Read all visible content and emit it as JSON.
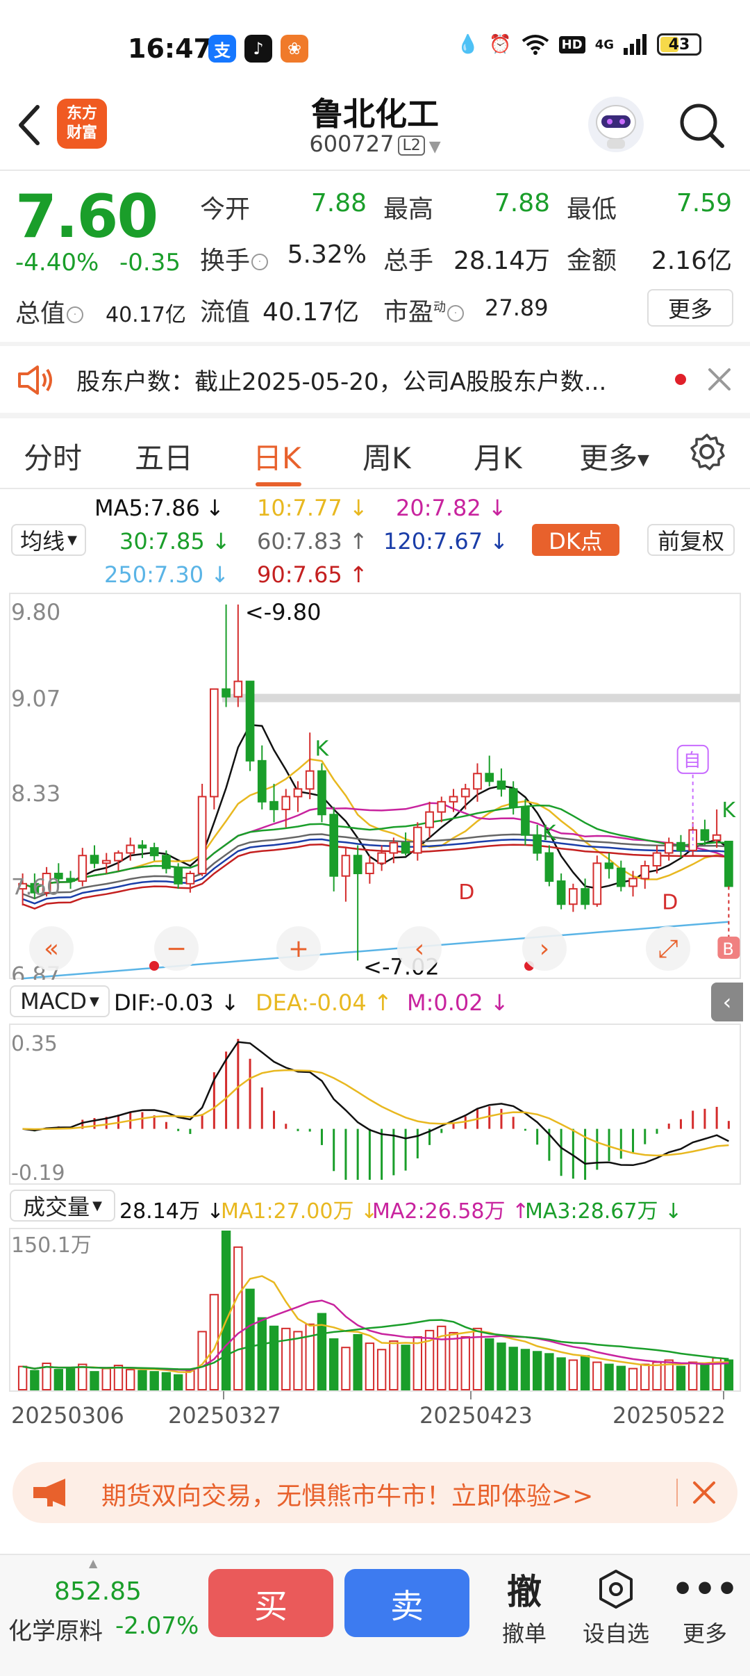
{
  "status_bar": {
    "time": "16:47",
    "app_icons": [
      "支",
      "♪",
      "❀"
    ],
    "network": "4G",
    "hd": "HD",
    "battery": "43"
  },
  "header": {
    "logo_line1": "东方",
    "logo_line2": "财富",
    "title": "鲁北化工",
    "code": "600727",
    "level": "L2"
  },
  "quote": {
    "price": "7.60",
    "change_pct": "-4.40%",
    "change": "-0.35",
    "open_label": "今开",
    "open": "7.88",
    "high_label": "最高",
    "high": "7.88",
    "low_label": "最低",
    "low": "7.59",
    "turnover_label": "换手",
    "turnover": "5.32%",
    "volume_label": "总手",
    "volume": "28.14万",
    "amount_label": "金额",
    "amount": "2.16亿",
    "mktcap_label": "总值",
    "mktcap": "40.17亿",
    "float_label": "流值",
    "float": "40.17亿",
    "pe_label": "市盈",
    "pe_sup": "动",
    "pe": "27.89",
    "more": "更多"
  },
  "notice": {
    "text": "股东户数：截止2025-05-20，公司A股股东户数..."
  },
  "tabs": [
    "分时",
    "五日",
    "日K",
    "周K",
    "月K",
    "更多"
  ],
  "active_tab": 2,
  "ma_legend": {
    "selector": "均线",
    "ma5": "MA5:7.86",
    "ma10": "10:7.77",
    "ma20": "20:7.82",
    "ma30": "30:7.85",
    "ma60": "60:7.83",
    "ma120": "120:7.67",
    "ma250": "250:7.30",
    "ma90": "90:7.65",
    "dk": "DK点",
    "adjust": "前复权"
  },
  "colors": {
    "up": "#d42c2c",
    "down": "#1a9e2a",
    "accent": "#e8612c",
    "ma5": "#111111",
    "ma10": "#e8b820",
    "ma20": "#c8239e",
    "ma30": "#1a9e2a",
    "ma60": "#666666",
    "ma120": "#1a3da8",
    "ma250": "#5ab4e6",
    "ma90": "#c42020"
  },
  "chart_data": [
    {
      "type": "candlestick",
      "ylim": [
        6.87,
        9.8
      ],
      "ytick_labels": [
        "9.80",
        "9.07",
        "8.33",
        "7.60",
        "6.87"
      ],
      "annotations": {
        "max": "<-9.80",
        "min": "<-7.02",
        "signals": [
          "K",
          "D",
          "K",
          "D",
          "K",
          "自",
          "B"
        ]
      },
      "candles": [
        [
          7.58,
          7.7,
          7.45,
          7.62
        ],
        [
          7.62,
          7.7,
          7.5,
          7.55
        ],
        [
          7.55,
          7.75,
          7.52,
          7.7
        ],
        [
          7.7,
          7.78,
          7.62,
          7.66
        ],
        [
          7.66,
          7.72,
          7.58,
          7.64
        ],
        [
          7.64,
          7.9,
          7.6,
          7.84
        ],
        [
          7.84,
          7.92,
          7.74,
          7.78
        ],
        [
          7.78,
          7.86,
          7.7,
          7.8
        ],
        [
          7.8,
          7.88,
          7.72,
          7.86
        ],
        [
          7.86,
          7.98,
          7.8,
          7.92
        ],
        [
          7.92,
          7.96,
          7.82,
          7.9
        ],
        [
          7.9,
          7.94,
          7.8,
          7.84
        ],
        [
          7.84,
          7.88,
          7.7,
          7.74
        ],
        [
          7.74,
          7.78,
          7.58,
          7.62
        ],
        [
          7.62,
          7.72,
          7.55,
          7.7
        ],
        [
          7.7,
          8.4,
          7.68,
          8.3
        ],
        [
          8.3,
          9.14,
          8.2,
          9.14
        ],
        [
          9.14,
          9.8,
          9.0,
          9.08
        ],
        [
          9.08,
          9.8,
          9.0,
          9.2
        ],
        [
          9.2,
          9.2,
          8.5,
          8.58
        ],
        [
          8.58,
          8.7,
          8.2,
          8.26
        ],
        [
          8.26,
          8.4,
          8.1,
          8.2
        ],
        [
          8.2,
          8.36,
          8.06,
          8.3
        ],
        [
          8.3,
          8.42,
          8.18,
          8.36
        ],
        [
          8.36,
          8.8,
          8.28,
          8.5
        ],
        [
          8.5,
          8.56,
          8.1,
          8.16
        ],
        [
          8.16,
          8.22,
          7.56,
          7.68
        ],
        [
          7.68,
          7.9,
          7.48,
          7.84
        ],
        [
          7.84,
          7.92,
          7.02,
          7.7
        ],
        [
          7.7,
          7.84,
          7.62,
          7.78
        ],
        [
          7.78,
          7.92,
          7.72,
          7.86
        ],
        [
          7.86,
          7.98,
          7.78,
          7.94
        ],
        [
          7.94,
          8.02,
          7.84,
          7.86
        ],
        [
          7.86,
          8.1,
          7.8,
          8.06
        ],
        [
          8.06,
          8.26,
          7.98,
          8.18
        ],
        [
          8.18,
          8.3,
          8.1,
          8.26
        ],
        [
          8.26,
          8.36,
          8.18,
          8.3
        ],
        [
          8.3,
          8.4,
          8.2,
          8.36
        ],
        [
          8.36,
          8.56,
          8.26,
          8.48
        ],
        [
          8.48,
          8.62,
          8.38,
          8.42
        ],
        [
          8.42,
          8.52,
          8.3,
          8.36
        ],
        [
          8.36,
          8.42,
          8.16,
          8.22
        ],
        [
          8.22,
          8.28,
          7.92,
          8.0
        ],
        [
          8.0,
          8.08,
          7.8,
          7.86
        ],
        [
          7.86,
          7.92,
          7.6,
          7.64
        ],
        [
          7.64,
          7.7,
          7.42,
          7.46
        ],
        [
          7.46,
          7.62,
          7.4,
          7.58
        ],
        [
          7.58,
          7.66,
          7.42,
          7.46
        ],
        [
          7.46,
          7.84,
          7.44,
          7.78
        ],
        [
          7.78,
          7.86,
          7.66,
          7.74
        ],
        [
          7.74,
          7.8,
          7.56,
          7.6
        ],
        [
          7.6,
          7.72,
          7.52,
          7.66
        ],
        [
          7.66,
          7.8,
          7.58,
          7.76
        ],
        [
          7.76,
          7.92,
          7.7,
          7.86
        ],
        [
          7.86,
          7.98,
          7.8,
          7.94
        ],
        [
          7.94,
          8.0,
          7.82,
          7.88
        ],
        [
          7.88,
          8.1,
          7.84,
          8.04
        ],
        [
          8.04,
          8.12,
          7.92,
          7.96
        ],
        [
          7.96,
          8.2,
          7.9,
          8.0
        ],
        [
          7.95,
          7.95,
          7.59,
          7.6
        ]
      ]
    },
    {
      "type": "macd",
      "selector": "MACD",
      "dif": "DIF:-0.03",
      "dea": "DEA:-0.04",
      "m": "M:0.02",
      "ylim": [
        -0.19,
        0.35
      ],
      "ytick_labels": [
        "0.35",
        "-0.19"
      ]
    },
    {
      "type": "volume",
      "selector": "成交量",
      "total": "28.14万",
      "ma1": "MA1:27.00万",
      "ma2": "MA2:26.58万",
      "ma3": "MA3:28.67万",
      "ytick_label": "150.1万",
      "x_labels": [
        "20250306",
        "20250327",
        "20250423",
        "20250522"
      ],
      "values": [
        22,
        18,
        25,
        19,
        21,
        24,
        17,
        20,
        23,
        19,
        18,
        17,
        16,
        14,
        18,
        55,
        90,
        150,
        135,
        95,
        68,
        60,
        58,
        55,
        62,
        72,
        48,
        40,
        52,
        44,
        38,
        46,
        42,
        50,
        56,
        60,
        54,
        50,
        58,
        48,
        44,
        40,
        38,
        36,
        34,
        30,
        28,
        32,
        26,
        24,
        22,
        20,
        24,
        26,
        28,
        22,
        26,
        24,
        30,
        28
      ]
    }
  ],
  "banner": {
    "text": "期货双向交易，无惧熊市牛市！立即体验>>"
  },
  "bottom": {
    "index_value": "852.85",
    "index_name": "化学原料",
    "index_change": "-2.07%",
    "buy": "买",
    "sell": "卖",
    "cancel_icon": "撤",
    "cancel": "撤单",
    "watch": "设自选",
    "more": "更多"
  }
}
